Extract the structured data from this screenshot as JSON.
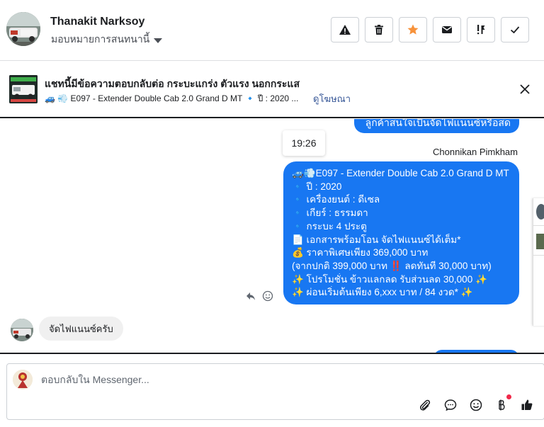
{
  "header": {
    "contact_name": "Thanakit Narksoy",
    "assign_label": "มอบหมายการสนทนานี้",
    "actions": [
      {
        "icon": "warning-icon"
      },
      {
        "icon": "trash-icon"
      },
      {
        "icon": "star-icon",
        "color": "#f7923b"
      },
      {
        "icon": "mail-icon"
      },
      {
        "icon": "follow-up-icon"
      },
      {
        "icon": "check-icon"
      }
    ]
  },
  "ad_banner": {
    "title": "แชทนี้มีข้อความตอบกลับต่อ กระบะแกร่ง ตัวแรง นอกกระแส",
    "subtitle": "🚙 💨 E097 - Extender Double Cab 2.0 Grand D MT  🔹 ปี : 2020 ...",
    "link": "ดูโฆษณา"
  },
  "conversation": {
    "previous_outgoing": "ลูกค้าสนใจเป็นจัดไฟแนนซ์หรือสดคะ",
    "timestamp": "19:26",
    "sender": "Chonnikan Pimkham",
    "outgoing_message_lines": [
      "🚙💨E097 - Extender Double Cab 2.0 Grand D MT",
      "🔹 ปี : 2020",
      "🔹 เครื่องยนต์ : ดีเซล",
      "🔹 เกียร์ : ธรรมดา",
      "🔹 กระบะ 4 ประตู",
      "📄 เอกสารพร้อมโอน จัดไฟแนนซ์ได้เต็ม*",
      "💰 ราคาพิเศษเพียง 369,000 บาท",
      "(จากปกติ 399,000 บาท ‼️ ลดทันที 30,000 บาท)",
      "✨ โปรโมชั่น ข้าวแลกลด รับส่วนลด 30,000 ✨",
      "✨ ผ่อนเริ่มต้นเพียง 6,xxx บาท / 84 งวด* ✨"
    ],
    "incoming_message": "จัดไฟแนนซ์ครับ"
  },
  "composer": {
    "placeholder": "ตอบกลับใน Messenger..."
  },
  "colors": {
    "accent": "#1877f2",
    "star": "#f7923b",
    "notification": "#f02849"
  }
}
